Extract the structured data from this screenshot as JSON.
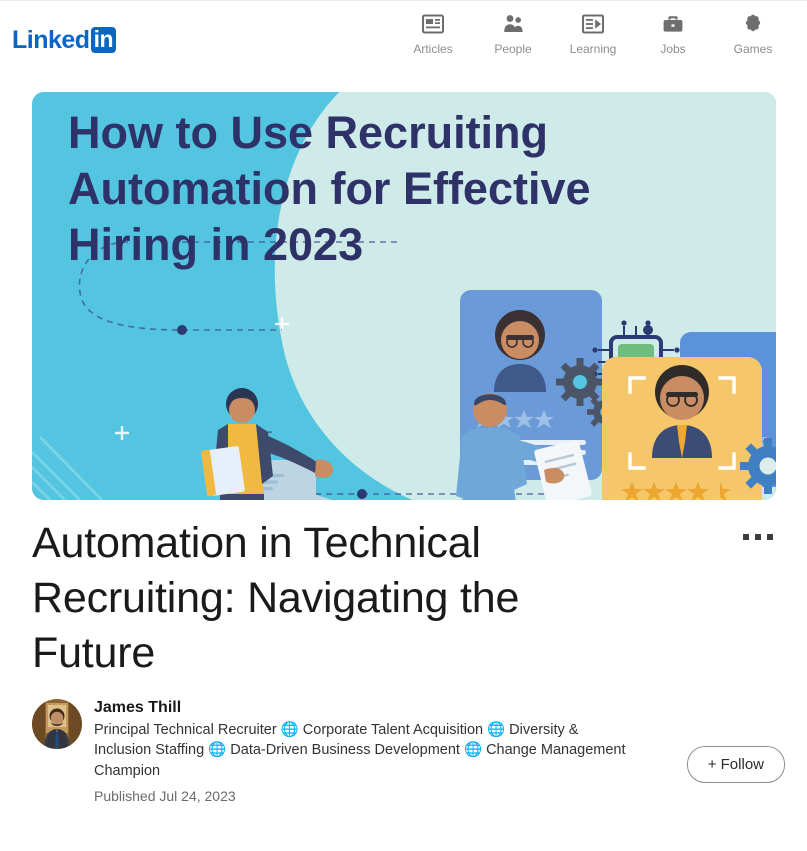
{
  "brand": {
    "name_word": "Linked",
    "name_badge": "in"
  },
  "nav": {
    "items": [
      {
        "label": "Articles",
        "icon": "articles-icon"
      },
      {
        "label": "People",
        "icon": "people-icon"
      },
      {
        "label": "Learning",
        "icon": "learning-icon"
      },
      {
        "label": "Jobs",
        "icon": "jobs-icon"
      },
      {
        "label": "Games",
        "icon": "games-icon"
      }
    ]
  },
  "hero": {
    "headline": "How to Use Recruiting Automation for Effective Hiring in 2023",
    "headline_lines": [
      "How to Use Recruiting",
      "Automation for Effective",
      "Hiring in 2023"
    ],
    "background_color": "#54c5e0",
    "headline_color": "#2e3269",
    "highlight_card_color": "#f5c76a",
    "accent_blue": "#4b7ec9",
    "check_color": "#2fa84f"
  },
  "article": {
    "title": "Automation in Technical Recruiting: Navigating the Future",
    "more_menu_label": "More actions"
  },
  "author": {
    "name": "James Thill",
    "headline": "Principal Technical Recruiter 🌐 Corporate Talent Acquisition 🌐 Diversity & Inclusion Staffing 🌐 Data-Driven Business Development 🌐 Change Management Champion",
    "published": "Published Jul 24, 2023",
    "follow_label": "+ Follow"
  },
  "colors": {
    "brand_blue": "#0a66c2",
    "text_primary": "#191919",
    "text_secondary": "#6b6b6b"
  }
}
